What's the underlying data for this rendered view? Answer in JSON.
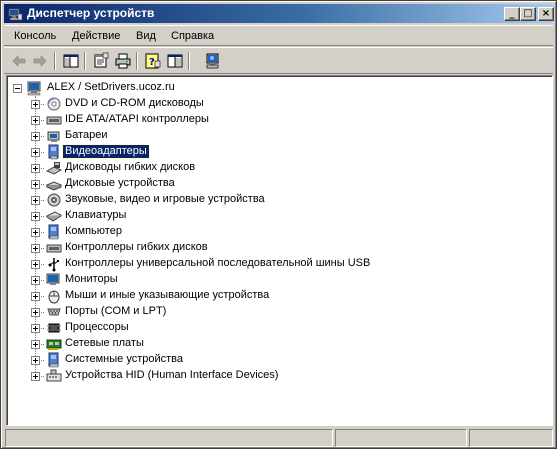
{
  "window": {
    "title": "Диспетчер устройств",
    "controls": {
      "minimize": "_",
      "maximize": "□",
      "close": "×"
    }
  },
  "menu": [
    "Консоль",
    "Действие",
    "Вид",
    "Справка"
  ],
  "toolbar": [
    {
      "name": "back-icon"
    },
    {
      "name": "forward-icon"
    },
    {
      "name": "show-hide-tree-icon"
    },
    {
      "name": "properties-icon"
    },
    {
      "name": "print-icon"
    },
    {
      "name": "help-icon"
    },
    {
      "name": "console-view-icon"
    },
    {
      "name": "scan-hardware-icon"
    }
  ],
  "tree": {
    "root": "ALEX / SetDrivers.ucoz.ru",
    "selected_index": 3,
    "items": [
      {
        "label": "DVD и CD-ROM дисководы",
        "icon": "dvd-drive-icon"
      },
      {
        "label": "IDE ATA/ATAPI контроллеры",
        "icon": "ide-controller-icon"
      },
      {
        "label": "Батареи",
        "icon": "battery-icon"
      },
      {
        "label": "Видеоадаптеры",
        "icon": "display-adapter-icon"
      },
      {
        "label": "Дисководы гибких дисков",
        "icon": "floppy-drive-icon"
      },
      {
        "label": "Дисковые устройства",
        "icon": "disk-drive-icon"
      },
      {
        "label": "Звуковые, видео и игровые устройства",
        "icon": "sound-device-icon"
      },
      {
        "label": "Клавиатуры",
        "icon": "keyboard-icon"
      },
      {
        "label": "Компьютер",
        "icon": "computer-icon"
      },
      {
        "label": "Контроллеры гибких дисков",
        "icon": "floppy-controller-icon"
      },
      {
        "label": "Контроллеры универсальной последовательной шины USB",
        "icon": "usb-controller-icon"
      },
      {
        "label": "Мониторы",
        "icon": "monitor-icon"
      },
      {
        "label": "Мыши и иные указывающие устройства",
        "icon": "mouse-icon"
      },
      {
        "label": "Порты (COM и LPT)",
        "icon": "port-icon"
      },
      {
        "label": "Процессоры",
        "icon": "processor-icon"
      },
      {
        "label": "Сетевые платы",
        "icon": "network-card-icon"
      },
      {
        "label": "Системные устройства",
        "icon": "system-device-icon"
      },
      {
        "label": "Устройства HID (Human Interface Devices)",
        "icon": "hid-device-icon"
      }
    ]
  },
  "colors": {
    "titlebar_start": "#0a246a",
    "titlebar_end": "#a6caf0",
    "selection": "#0a246a",
    "face": "#d4d0c8"
  }
}
